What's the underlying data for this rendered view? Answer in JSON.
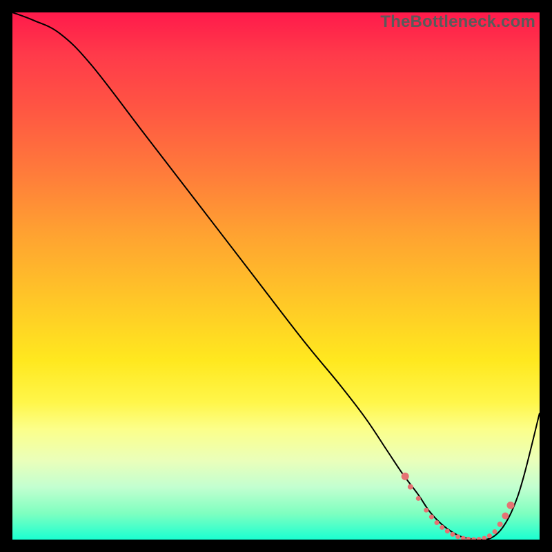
{
  "watermark": "TheBottleneck.com",
  "colors": {
    "curve": "#000000",
    "dot": "#e57373",
    "frame_bg": "#000000"
  },
  "chart_data": {
    "type": "line",
    "title": "",
    "xlabel": "",
    "ylabel": "",
    "xlim": [
      0,
      100
    ],
    "ylim": [
      0,
      100
    ],
    "grid": false,
    "legend": false,
    "series": [
      {
        "name": "bottleneck-curve",
        "x": [
          0,
          4,
          9,
          15,
          25,
          35,
          45,
          55,
          62,
          67,
          71,
          74,
          77,
          79,
          81,
          83,
          85,
          87,
          89,
          91,
          93,
          95,
          97,
          100
        ],
        "y": [
          100,
          98.5,
          96,
          90,
          77,
          64,
          51,
          38,
          29.5,
          23,
          17,
          12.5,
          8.5,
          5.5,
          3.3,
          1.7,
          0.6,
          0.15,
          0,
          0.4,
          2.3,
          6,
          12,
          24
        ]
      }
    ],
    "markers": {
      "name": "minimum-band-dots",
      "x": [
        74.5,
        75.5,
        77,
        78.5,
        79.5,
        80.5,
        81.5,
        82.5,
        83.5,
        84.5,
        85.5,
        86.5,
        87.5,
        88.5,
        89.5,
        90.5,
        91.5,
        92.5,
        93.5,
        94.5
      ],
      "y": [
        12,
        10,
        7.8,
        5.6,
        4.3,
        3.2,
        2.3,
        1.6,
        1.0,
        0.55,
        0.25,
        0.08,
        0.0,
        0.05,
        0.25,
        0.7,
        1.5,
        2.9,
        4.5,
        6.5
      ],
      "r": [
        5.5,
        4,
        3.5,
        3.5,
        3.5,
        3.5,
        3.5,
        3.5,
        3.5,
        3.5,
        3.5,
        3.5,
        3.5,
        3.5,
        3.5,
        3.5,
        3.5,
        4,
        5,
        5.5
      ]
    }
  }
}
